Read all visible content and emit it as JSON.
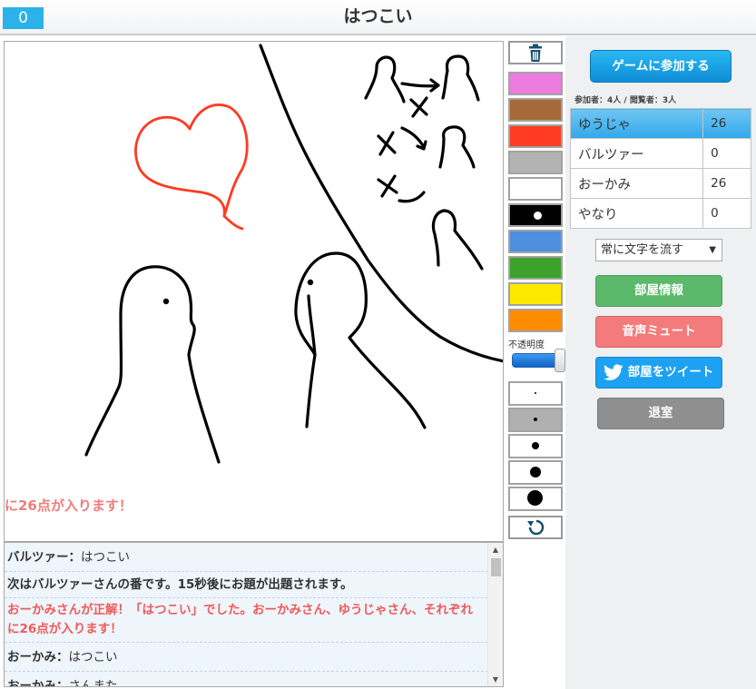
{
  "header": {
    "timer": "0",
    "title": "はつこい",
    "timer_color": "#2bb2e9"
  },
  "canvas": {
    "ticker_text": "に26点が入ります！"
  },
  "chat": {
    "messages": [
      {
        "type": "user",
        "name": "バルツァー：",
        "text": "はつこい"
      },
      {
        "type": "system",
        "text": "次はバルツァーさんの番です。15秒後にお題が出題されます。"
      },
      {
        "type": "correct",
        "text": "おーかみさんが正解！「はつこい」でした。おーかみさん、ゆうじゃさん、それぞれに26点が入ります！"
      },
      {
        "type": "user",
        "name": "おーかみ：",
        "text": "はつこい"
      },
      {
        "type": "user",
        "name": "おーかみ：",
        "text": "さんまた"
      }
    ]
  },
  "tools": {
    "trash_icon": "trash-icon",
    "palette": [
      {
        "name": "pink",
        "color": "#ee7be0"
      },
      {
        "name": "brown",
        "color": "#a66a3a"
      },
      {
        "name": "red",
        "color": "#ff3b22"
      },
      {
        "name": "gray",
        "color": "#b3b3b3"
      },
      {
        "name": "white",
        "color": "#ffffff"
      },
      {
        "name": "black",
        "color": "#000000"
      },
      {
        "name": "blue",
        "color": "#4f8fe0"
      },
      {
        "name": "green",
        "color": "#3ca22a"
      },
      {
        "name": "yellow",
        "color": "#ffe800"
      },
      {
        "name": "orange",
        "color": "#ff8c00"
      }
    ],
    "opacity_label": "不透明度",
    "undo_icon": "undo-icon"
  },
  "side": {
    "join_label": "ゲームに参加する",
    "count_line": "参加者：4人 / 閲覧者：3人",
    "players": [
      {
        "name": "ゆうじゃ",
        "score": "26",
        "active": true
      },
      {
        "name": "バルツァー",
        "score": "0",
        "active": false
      },
      {
        "name": "おーかみ",
        "score": "26",
        "active": false
      },
      {
        "name": "やなり",
        "score": "0",
        "active": false
      }
    ],
    "scroll_mode": "常に文字を流す",
    "room_info_label": "部屋情報",
    "mute_label": "音声ミュート",
    "tweet_label": "部屋をツイート",
    "leave_label": "退室"
  }
}
